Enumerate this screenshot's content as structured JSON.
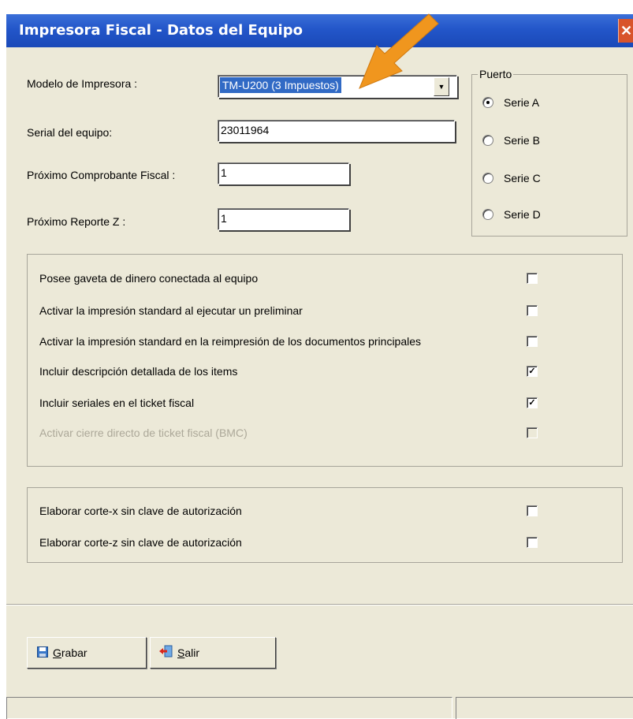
{
  "window": {
    "title": "Impresora Fiscal - Datos del Equipo",
    "close_glyph": "✕"
  },
  "fields": {
    "modelo_label": "Modelo  de Impresora :",
    "modelo_value": "TM-U200 (3 Impuestos)",
    "serial_label": "Serial del equipo:",
    "serial_value": "23011964",
    "prox_comprobante_label": "Próximo Comprobante Fiscal :",
    "prox_comprobante_value": "1",
    "prox_reporte_label": "Próximo Reporte Z :",
    "prox_reporte_value": "1"
  },
  "puerto": {
    "legend": "Puerto",
    "options": [
      {
        "label": "Serie A",
        "selected": true
      },
      {
        "label": "Serie B",
        "selected": false
      },
      {
        "label": "Serie C",
        "selected": false
      },
      {
        "label": "Serie D",
        "selected": false
      }
    ]
  },
  "options_group": [
    {
      "label": "Posee gaveta de dinero conectada al equipo",
      "checked": false,
      "enabled": true
    },
    {
      "label": "Activar la impresión standard al ejecutar un preliminar",
      "checked": false,
      "enabled": true
    },
    {
      "label": "Activar la impresión standard en la reimpresión de los documentos principales",
      "checked": false,
      "enabled": true
    },
    {
      "label": "Incluir  descripción detallada de los items",
      "checked": true,
      "enabled": true
    },
    {
      "label": "Incluir seriales en el ticket fiscal",
      "checked": true,
      "enabled": true
    },
    {
      "label": "Activar cierre directo de ticket fiscal  (BMC)",
      "checked": false,
      "enabled": false
    }
  ],
  "corte_group": [
    {
      "label": "Elaborar corte-x sin clave de autorización",
      "checked": false
    },
    {
      "label": "Elaborar corte-z sin clave de autorización",
      "checked": false
    }
  ],
  "buttons": {
    "grabar_mnemonic": "G",
    "grabar_rest": "rabar",
    "salir_mnemonic": "S",
    "salir_rest": "alir"
  },
  "icons": {
    "grabar": "floppy-disk-icon",
    "salir": "exit-door-icon",
    "annotation": "orange-arrow-icon"
  },
  "colors": {
    "title_bar": "#2356c9",
    "selection": "#316ac5",
    "dialog_bg": "#ece9d8",
    "close_button": "#d8542b",
    "arrow": "#f0961e"
  }
}
